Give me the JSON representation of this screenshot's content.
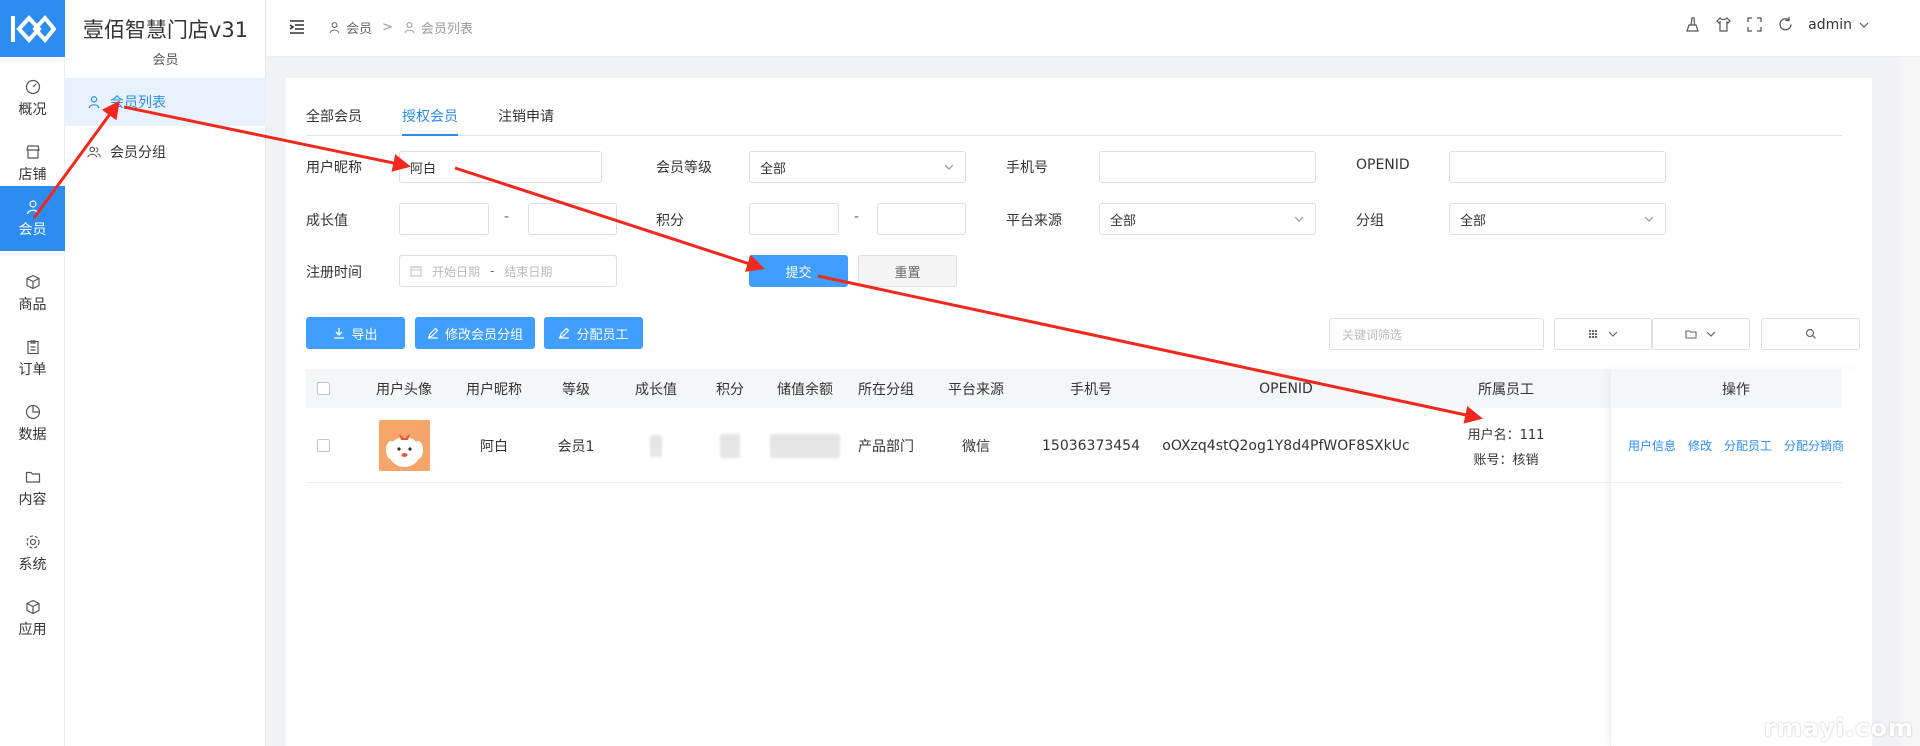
{
  "rail": {
    "items": [
      {
        "label": "概况",
        "icon": "gauge-icon"
      },
      {
        "label": "店铺",
        "icon": "store-icon"
      },
      {
        "label": "会员",
        "icon": "user-icon",
        "active": true
      },
      {
        "label": "商品",
        "icon": "box-icon"
      },
      {
        "label": "订单",
        "icon": "clipboard-icon"
      },
      {
        "label": "数据",
        "icon": "pie-icon"
      },
      {
        "label": "内容",
        "icon": "folder-icon"
      },
      {
        "label": "系统",
        "icon": "gear-icon"
      },
      {
        "label": "应用",
        "icon": "cube-icon"
      }
    ]
  },
  "sidebar": {
    "shop_title": "壹佰智慧门店v31",
    "section": "会员",
    "items": [
      {
        "label": "会员列表",
        "active": true
      },
      {
        "label": "会员分组"
      }
    ]
  },
  "header": {
    "breadcrumb": [
      "会员",
      "会员列表"
    ],
    "breadcrumb_sep": ">",
    "user": "admin"
  },
  "tabs": [
    "全部会员",
    "授权会员",
    "注销申请"
  ],
  "filters": {
    "nickname_label": "用户昵称",
    "nickname_value": "阿白",
    "level_label": "会员等级",
    "level_value": "全部",
    "phone_label": "手机号",
    "openid_label": "OPENID",
    "growth_label": "成长值",
    "points_label": "积分",
    "source_label": "平台来源",
    "source_value": "全部",
    "group_label": "分组",
    "group_value": "全部",
    "regtime_label": "注册时间",
    "start_placeholder": "开始日期",
    "end_placeholder": "结束日期",
    "range_sep": "-",
    "submit": "提交",
    "reset": "重置"
  },
  "actions": {
    "export": "导出",
    "edit_group": "修改会员分组",
    "assign_staff": "分配员工",
    "keyword_placeholder": "关键词筛选"
  },
  "table": {
    "columns": [
      "用户头像",
      "用户昵称",
      "等级",
      "成长值",
      "积分",
      "储值余额",
      "所在分组",
      "平台来源",
      "手机号",
      "OPENID",
      "所属员工",
      "操作"
    ],
    "rows": [
      {
        "nickname": "阿白",
        "level": "会员1",
        "group": "产品部门",
        "source": "微信",
        "phone": "15036373454",
        "openid": "oOXzq4stQ2og1Y8d4PfWOF8SXkUc",
        "staff_user": "用户名：111",
        "staff_account": "账号：核销",
        "ops": [
          "用户信息",
          "修改",
          "分配员工",
          "分配分销商"
        ]
      }
    ]
  },
  "watermark": {
    "text": "rmayi.com"
  },
  "colors": {
    "primary": "#2d8cf0",
    "button": "#409eff",
    "arrow": "#f0281e"
  }
}
